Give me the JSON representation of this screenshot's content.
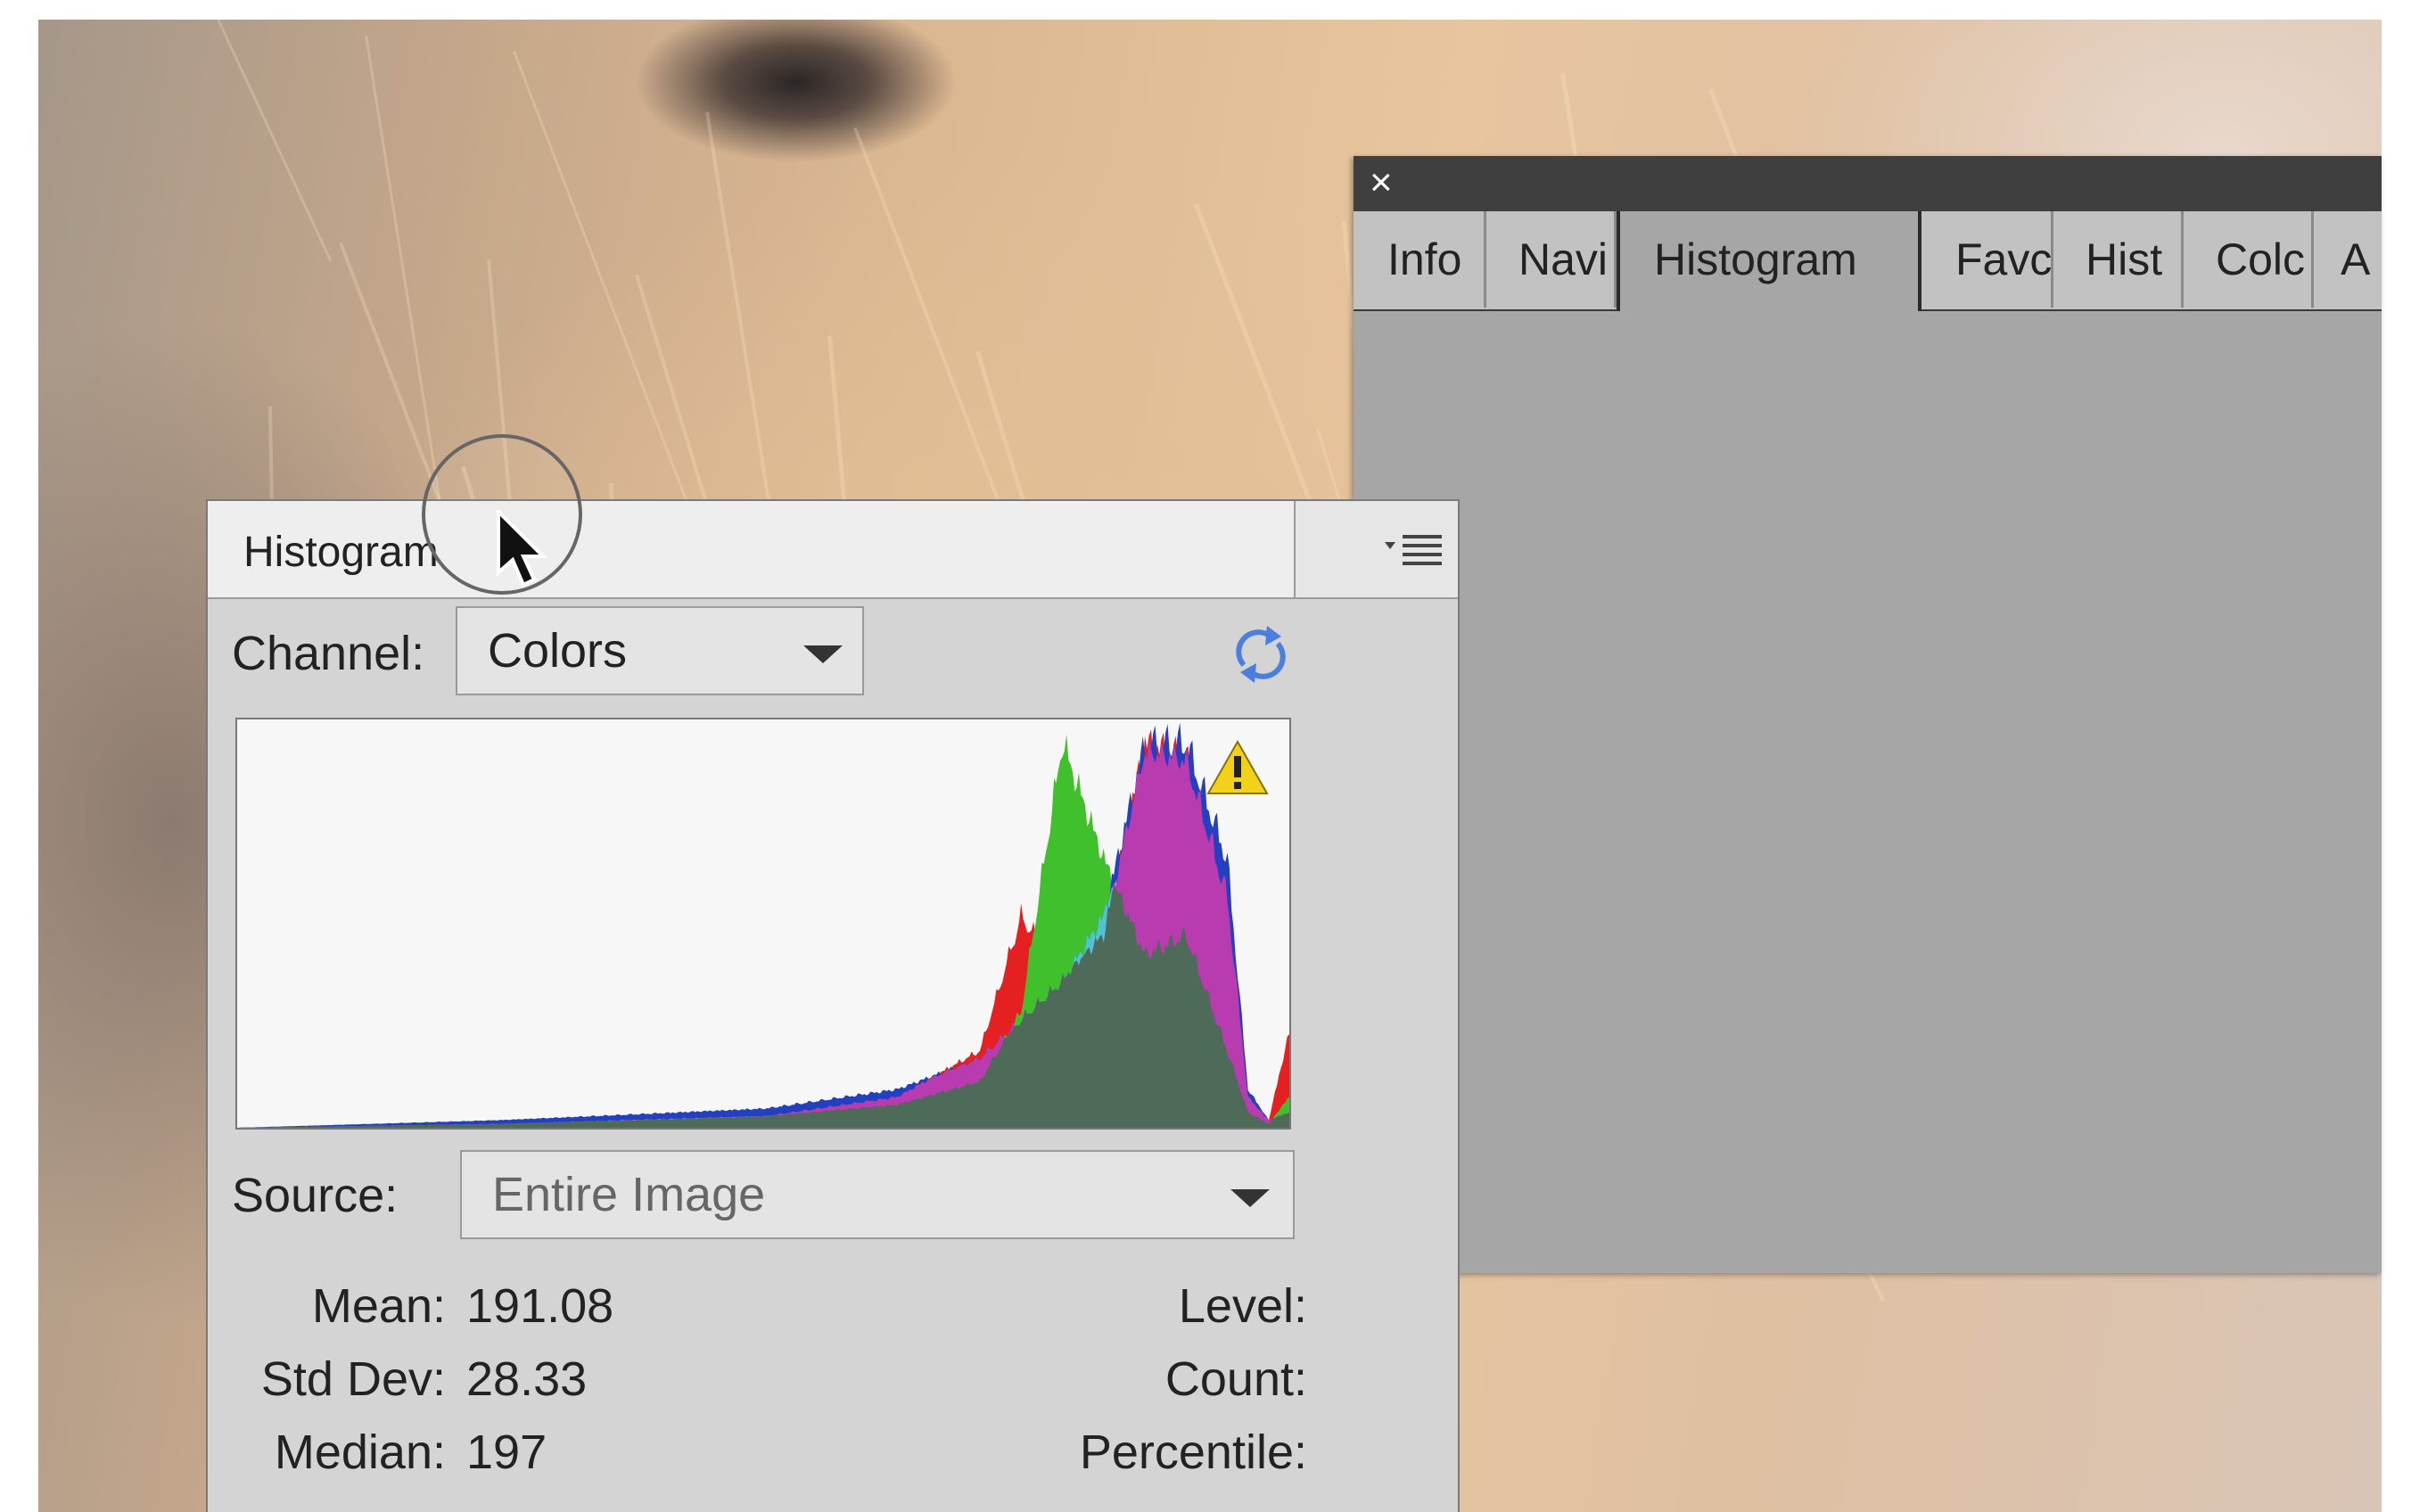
{
  "back_panel": {
    "close_glyph": "×",
    "tabs": [
      {
        "label": "Info",
        "active": false
      },
      {
        "label": "Navi",
        "active": false
      },
      {
        "label": "Histogram",
        "active": true
      },
      {
        "label": "Favc",
        "active": false
      },
      {
        "label": "Hist",
        "active": false
      },
      {
        "label": "Colc",
        "active": false
      },
      {
        "label": "A",
        "active": false
      }
    ]
  },
  "histogram_panel": {
    "tab_label": "Histogram",
    "menu_icon": "panel-menu-icon",
    "channel_label": "Channel:",
    "channel_value": "Colors",
    "refresh_icon": "refresh-icon",
    "warning_icon": "warning-icon",
    "source_label": "Source:",
    "source_value": "Entire Image",
    "stats": {
      "mean_label": "Mean:",
      "mean_value": "191.08",
      "std_label": "Std Dev:",
      "std_value": "28.33",
      "median_label": "Median:",
      "median_value": "197",
      "level_label": "Level:",
      "count_label": "Count:",
      "percentile_label": "Percentile:"
    }
  },
  "colors": {
    "red": "#e42020",
    "green": "#3fc02c",
    "blue": "#2340c0",
    "cyan": "#4fc2d4",
    "yellow": "#d8e43a",
    "magenta": "#b83cb0",
    "gray": "#4e6a58"
  },
  "chart_data": {
    "type": "area",
    "x": [
      0,
      64,
      128,
      160,
      180,
      190,
      200,
      210,
      220,
      230,
      240,
      245,
      250,
      255
    ],
    "series": [
      {
        "values": [
          0,
          1,
          3,
          8,
          20,
          55,
          40,
          50,
          100,
          96,
          60,
          8,
          2,
          25
        ]
      },
      {
        "values": [
          0,
          1,
          3,
          6,
          12,
          30,
          100,
          70,
          45,
          50,
          20,
          4,
          1,
          8
        ]
      },
      {
        "values": [
          0,
          2,
          5,
          10,
          18,
          28,
          38,
          55,
          100,
          100,
          70,
          10,
          2,
          4
        ]
      }
    ],
    "xlim": [
      0,
      255
    ],
    "ylim": [
      0,
      100
    ]
  },
  "cursor": {
    "shape": "arrow"
  }
}
